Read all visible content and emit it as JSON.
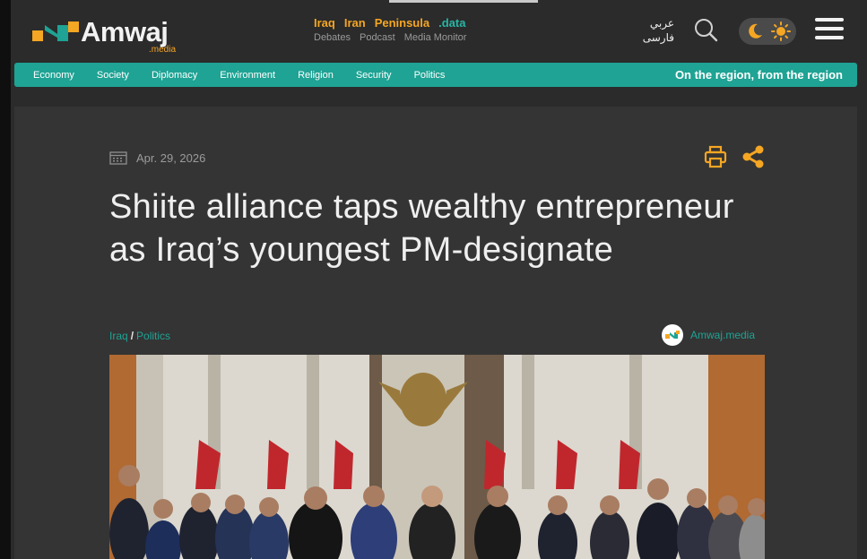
{
  "header": {
    "logo_text": "Amwaj",
    "logo_sub": ".media",
    "sections_primary": [
      "Iraq",
      "Iran",
      "Peninsula",
      ".data"
    ],
    "sections_secondary": [
      "Debates",
      "Podcast",
      "Media Monitor"
    ],
    "languages": [
      "عربي",
      "فارسی"
    ],
    "icons": {
      "search": "search-icon",
      "theme_moon": "moon-icon",
      "theme_sun": "sun-icon",
      "menu": "hamburger-menu-icon"
    }
  },
  "nav": {
    "items": [
      "Economy",
      "Society",
      "Diplomacy",
      "Environment",
      "Religion",
      "Security",
      "Politics"
    ],
    "tagline": "On the region, from the region"
  },
  "article": {
    "date": "Apr. 29, 2026",
    "title": "Shiite alliance taps wealthy entrepreneur as Iraq’s youngest PM-designate",
    "breadcrumb": [
      "Iraq",
      "Politics"
    ],
    "breadcrumb_separator": "/",
    "source": "Amwaj.media",
    "icons": {
      "date": "calendar-icon",
      "print": "print-icon",
      "share": "share-icon"
    }
  },
  "colors": {
    "accent_orange": "#f5a623",
    "accent_teal": "#1ea394",
    "background": "#2b2b2b",
    "article_background": "#343434"
  }
}
